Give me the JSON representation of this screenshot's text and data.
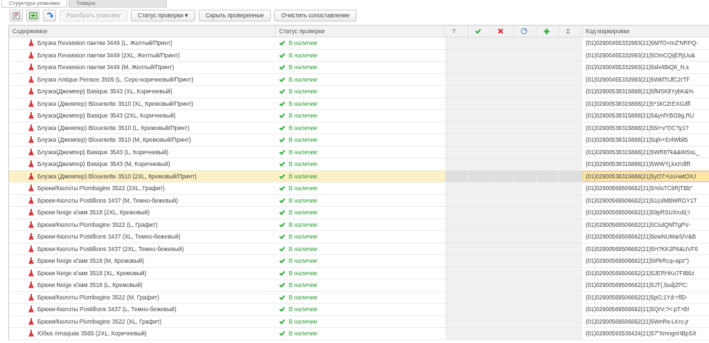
{
  "tabs": [
    {
      "label": "Структура упаковки",
      "selected": true
    },
    {
      "label": "Товары",
      "selected": false
    }
  ],
  "toolbar": {
    "buttons": [
      {
        "kind": "grid",
        "disabled": false
      },
      {
        "kind": "sheet",
        "disabled": false
      },
      {
        "kind": "arrow",
        "disabled": false
      },
      {
        "kind": "text",
        "label": "Разобрать упаковку",
        "disabled": true
      },
      {
        "kind": "dropdown",
        "label": "Статус проверки",
        "caret": "▾",
        "disabled": false
      },
      {
        "kind": "text",
        "label": "Скрыть проверенные",
        "disabled": false
      },
      {
        "kind": "text",
        "label": "Очистить сопоставление",
        "disabled": false
      }
    ]
  },
  "table": {
    "columns": [
      {
        "kind": "text",
        "label": "Содержимое"
      },
      {
        "kind": "text",
        "label": "Статус проверки"
      },
      {
        "kind": "symbol",
        "label": "?"
      },
      {
        "kind": "check"
      },
      {
        "kind": "cross"
      },
      {
        "kind": "clock"
      },
      {
        "kind": "plus"
      },
      {
        "kind": "symbol",
        "label": "Σ"
      },
      {
        "kind": "text",
        "label": "Код маркировки"
      }
    ],
    "rows": [
      {
        "name": "Блузка Revassion паетки 3449 (L, Желтый/Принт)",
        "status": {
          "kind": "in_stock",
          "text": "В наличии"
        },
        "code": "(01)02900455332993(21)5MTO<mZ'NRPQ-",
        "selected": false
      },
      {
        "name": "Блузка Revassion паетки 3449 (2XL, Желтый/Принт)",
        "status": {
          "kind": "in_stock",
          "text": "В наличии"
        },
        "code": "(01)02900455332993(21)5OmCQijERjUu&",
        "selected": false
      },
      {
        "name": "Блузка Revassion паетки 3449 (M, Желтый/Принт)",
        "status": {
          "kind": "in_stock",
          "text": "В наличии"
        },
        "code": "(01)02900455332993(21)5slx4BiQ8_N,s",
        "selected": false
      },
      {
        "name": "Блузка Antique Pensee 3505 (L, Серо-коричневый/Принт)",
        "status": {
          "kind": "in_stock",
          "text": "В наличии"
        },
        "code": "(01)02900455332993(21)5WkfTtJfC2rTF",
        "selected": false
      },
      {
        "name": "Блузка(Джемпер) Basique 3543 (XL, Коричневый)",
        "status": {
          "kind": "in_stock",
          "text": "В наличии"
        },
        "code": "(01)02900538315868(21)5fMSKltYybK&%",
        "selected": false
      },
      {
        "name": "Блузка (Джемпер) Blouesette 3510 (XL, Кремовый/Принт)",
        "status": {
          "kind": "in_stock",
          "text": "В наличии"
        },
        "code": "(01)02900538315868(21)5*1kCZrEXGdfl",
        "selected": false
      },
      {
        "name": "Блузка(Джемпер) Basique 3543 (2XL, Коричневый)",
        "status": {
          "kind": "in_stock",
          "text": "В наличии"
        },
        "code": "(01)02900538315868(21)5&ynfYBG9g,RU",
        "selected": false
      },
      {
        "name": "Блузка (Джемпер) Blouesette 3510 (L, Кремовый/Принт)",
        "status": {
          "kind": "in_stock",
          "text": "В наличии"
        },
        "code": "(01)02900538315868(21)55I+v\"OC\"ty1?",
        "selected": false
      },
      {
        "name": "Блузка (Джемпер) Blouesette 3510 (M, Кремовый/Принт)",
        "status": {
          "kind": "in_stock",
          "text": "В наличии"
        },
        "code": "(01)02900538315868(21)5qln+EnlWbli5",
        "selected": false
      },
      {
        "name": "Блузка(Джемпер) Basique 3543 (L, Коричневый)",
        "status": {
          "kind": "in_stock",
          "text": "В наличии"
        },
        "code": "(01)02900538315868(21)5WR8Tk&&WSsL_",
        "selected": false
      },
      {
        "name": "Блузка(Джемпер) Basique 3543 (M, Коричневый)",
        "status": {
          "kind": "in_stock",
          "text": "В наличии"
        },
        "code": "(01)02900538315868(21)5WWYj,kxz!dlR",
        "selected": false
      },
      {
        "name": "Блузка (Джемпер) Blouesette 3510 (2XL, Кремовый/Принт)",
        "status": {
          "kind": "in_stock",
          "text": "В наличии"
        },
        "code": "(01)02900538315868(21)5yO7>UoAwtOXJ",
        "selected": true
      },
      {
        "name": "Брюки/Кюлоты Plombagine 3522 (2XL, Графит)",
        "status": {
          "kind": "in_stock",
          "text": "В наличии"
        },
        "code": "(01)02900569506662(21)5%luTC9RjTBb\"",
        "selected": false
      },
      {
        "name": "Брюки-Кюлоты Postillions 3437 (M, Темно-бежевый)",
        "status": {
          "kind": "in_stock",
          "text": "В наличии"
        },
        "code": "(01)02900569506662(21)51(olMBWRGY1T",
        "selected": false
      },
      {
        "name": "Брюки Neige к/зам 3518 (2XL, Кремовый)",
        "status": {
          "kind": "in_stock",
          "text": "В наличии"
        },
        "code": "(01)02900569506662(21)59pRSUXru6(:I",
        "selected": false
      },
      {
        "name": "Брюки/Кюлоты Plombagine 3522 (L, Графит)",
        "status": {
          "kind": "in_stock",
          "text": "В наличии"
        },
        "code": "(01)02900569506662(21)5CiulQNfTgPV-",
        "selected": false
      },
      {
        "name": "Брюки-Кюлоты Postillions 3437 (XL, Темно-бежевый)",
        "status": {
          "kind": "in_stock",
          "text": "В наличии"
        },
        "code": "(01)02900569506662(21)5ewNUMaiS/V&B",
        "selected": false
      },
      {
        "name": "Брюки-Кюлоты Postillions 3437 (2XL, Темно-бежевый)",
        "status": {
          "kind": "in_stock",
          "text": "В наличии"
        },
        "code": "(01)02900569506662(21)5H?KK2P6&UVF6",
        "selected": false
      },
      {
        "name": "Брюки Neige к/зам 3518 (M, Кремовый)",
        "status": {
          "kind": "in_stock",
          "text": "В наличии"
        },
        "code": "(01)02900569506662(21)5iPkRcq=apz\")",
        "selected": false
      },
      {
        "name": "Брюки Neige к/зам 3518 (XL, Кремовый)",
        "status": {
          "kind": "in_stock",
          "text": "В наличии"
        },
        "code": "(01)02900569506662(21)5JERHKo7FIB6z",
        "selected": false
      },
      {
        "name": "Брюки Neige к/зам 3518 (L, Кремовый)",
        "status": {
          "kind": "in_stock",
          "text": "В наличии"
        },
        "code": "(01)02900569506662(21)5JT(,5udjZPC:",
        "selected": false
      },
      {
        "name": "Брюки/Кюлоты Plombagine 3522 (M, Графит)",
        "status": {
          "kind": "in_stock",
          "text": "В наличии"
        },
        "code": "(01)02900569506662(21)5pG;1Yd:+flD-",
        "selected": false
      },
      {
        "name": "Брюки-Кюлоты Postillions 3437 (L, Темно-бежевый)",
        "status": {
          "kind": "in_stock",
          "text": "В наличии"
        },
        "code": "(01)02900569506662(21)5QrV;?<:pT>B!",
        "selected": false
      },
      {
        "name": "Брюки/Кюлоты Plombagine 3522 (XL, Графит)",
        "status": {
          "kind": "in_stock",
          "text": "В наличии"
        },
        "code": "(01)02900569506662(21)5WnRs-LKro.jr",
        "selected": false
      },
      {
        "name": "Юбка Amaquas 3565 (2XL, Коричневый)",
        "status": {
          "kind": "in_stock",
          "text": "В наличии"
        },
        "code": "(01)02900593538424(21)57\"XmngnHBpSX",
        "selected": false
      }
    ]
  }
}
